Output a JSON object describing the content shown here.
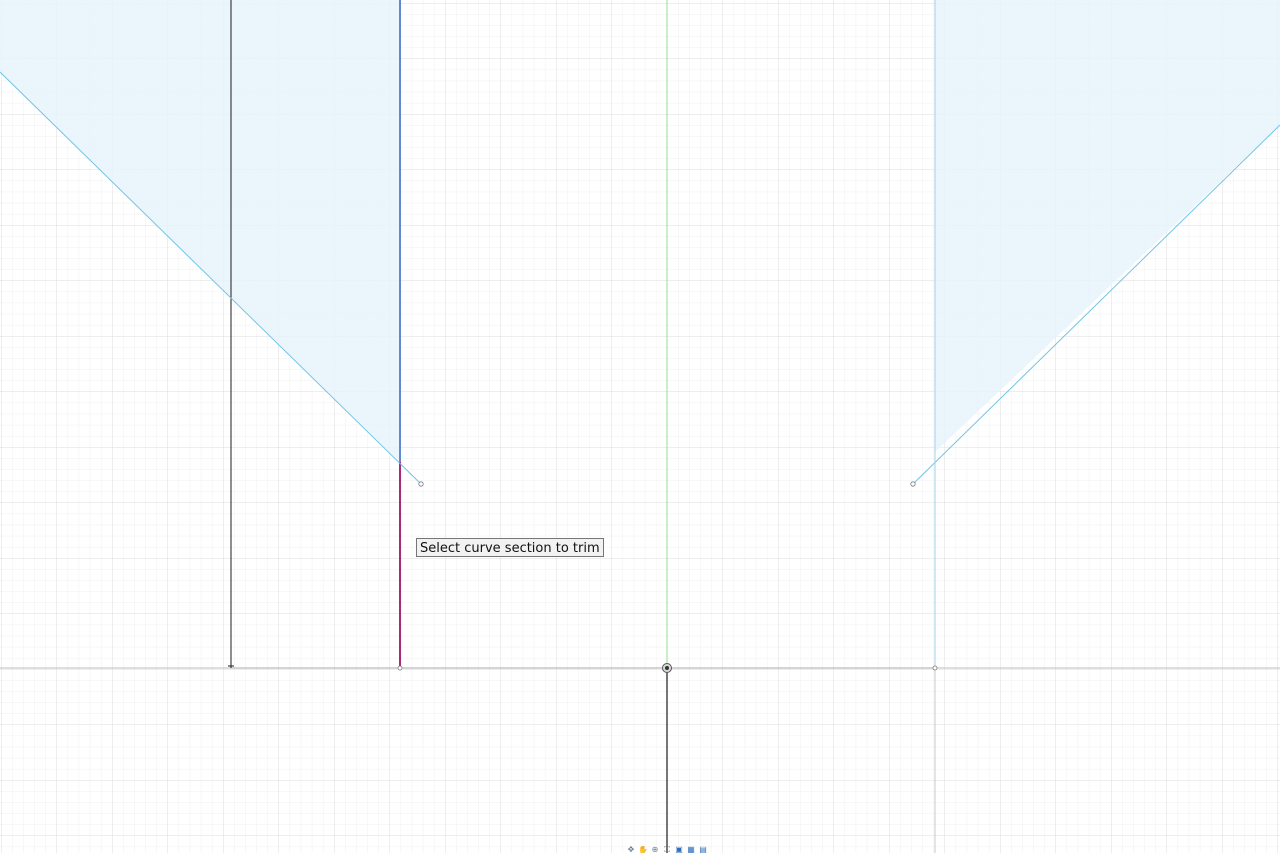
{
  "tooltip": {
    "text": "Select curve section to trim"
  },
  "colors": {
    "background": "#ffffff",
    "grid_minor": "#f0f0f0",
    "grid_major": "#dedede",
    "profile_fill": "#e6f3fc",
    "profile_edge": "#72c4e4",
    "selected_line": "#3d6fcb",
    "trim_highlight": "#a0116d",
    "axis_green": "#8fe08f",
    "construction_black": "#1c1c1c",
    "axis_grey": "#bcbcbc"
  },
  "navigation_bar": {
    "icons": [
      "orbit-icon",
      "pan-icon",
      "zoom-icon",
      "fit-icon",
      "display-settings-icon",
      "grid-settings-icon",
      "viewports-icon"
    ]
  }
}
